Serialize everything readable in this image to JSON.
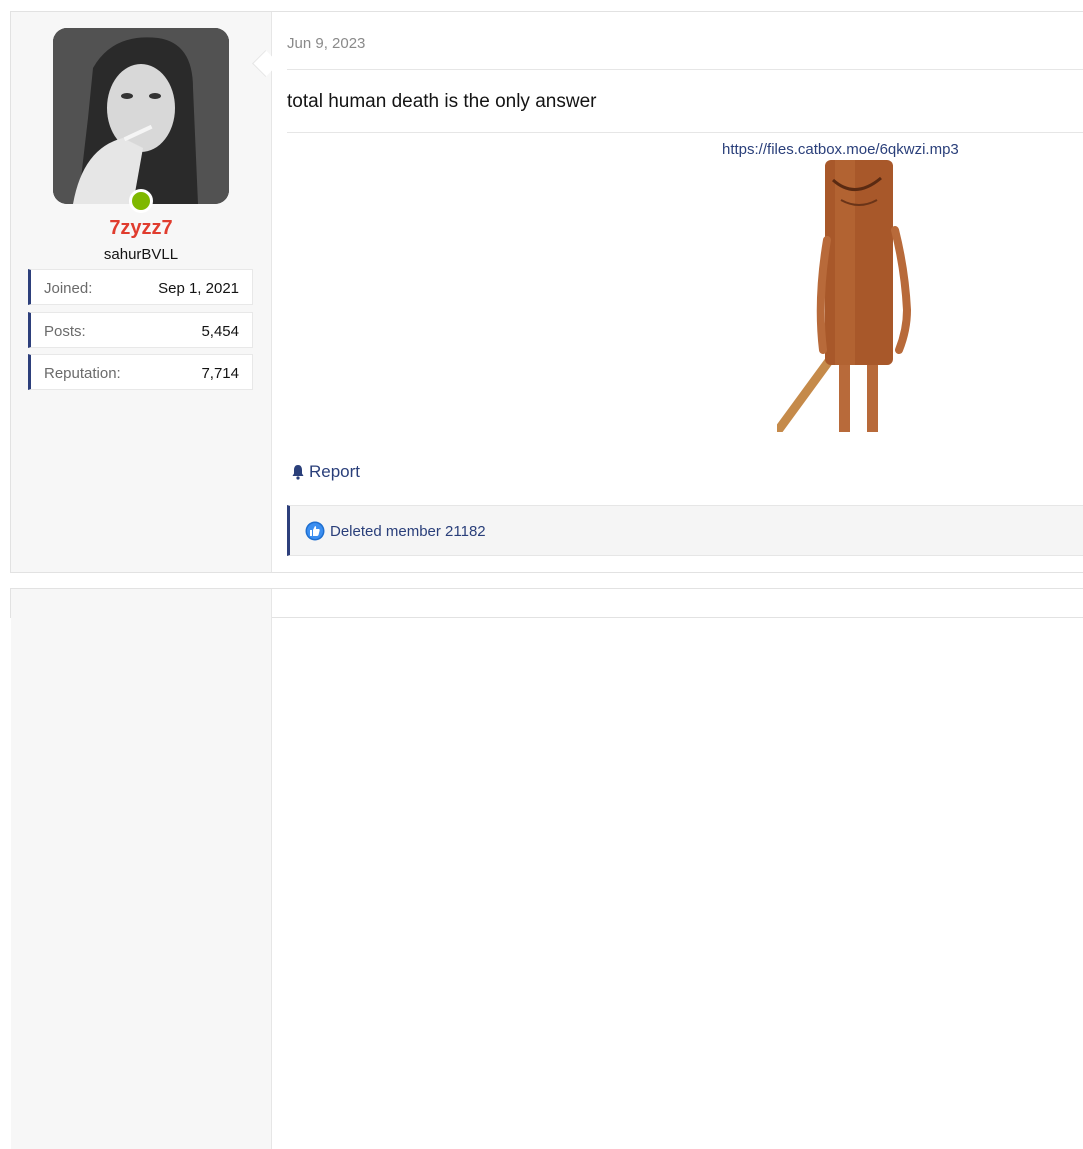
{
  "post": {
    "date": "Jun 9, 2023",
    "message": "total human death is the only answer",
    "link": "https://files.catbox.moe/6qkwzi.mp3",
    "report_label": "Report",
    "reaction_user": "Deleted member 21182"
  },
  "user": {
    "name": "7zyzz7",
    "title": "sahurBVLL",
    "online": true,
    "stats": [
      {
        "label": "Joined:",
        "value": "Sep 1, 2021"
      },
      {
        "label": "Posts:",
        "value": "5,454"
      },
      {
        "label": "Reputation:",
        "value": "7,714"
      }
    ]
  },
  "icons": {
    "report": "bell-icon",
    "reaction": "thumbs-up-icon"
  },
  "colors": {
    "username": "#e03c2e",
    "accent": "#2d3f7b",
    "link": "#2a3f7a",
    "online": "#7fb800"
  }
}
